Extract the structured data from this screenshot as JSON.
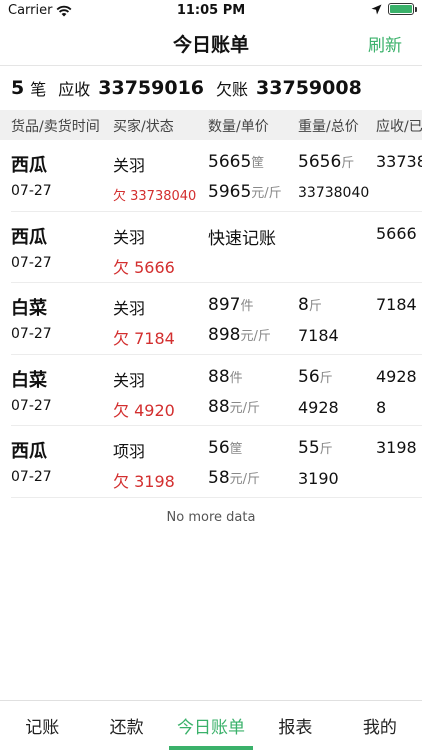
{
  "status_bar": {
    "carrier": "Carrier",
    "time": "11:05 PM"
  },
  "nav": {
    "title": "今日账单",
    "refresh_label": "刷新"
  },
  "summary": {
    "count": "5",
    "count_unit": "笔",
    "receivable_label": "应收",
    "receivable_value": "33759016",
    "owed_label": "欠账",
    "owed_value": "33759008"
  },
  "table_header": {
    "goods_time": "货品/卖货时间",
    "buyer_status": "买家/状态",
    "qty_price": "数量/单价",
    "weight_total": "重量/总价",
    "due": "应收/已"
  },
  "rows": [
    {
      "goods": "西瓜",
      "date": "07-27",
      "buyer": "关羽",
      "status": "欠 33738040",
      "qty": "5665",
      "qty_unit": "筐",
      "price": "5965",
      "price_unit": "元/斤",
      "weight": "5656",
      "weight_unit": "斤",
      "total": "33738040",
      "due": "33738",
      "due2": ""
    },
    {
      "goods": "西瓜",
      "date": "07-27",
      "buyer": "关羽",
      "status": "欠 5666",
      "qty": "快速记账",
      "qty_unit": "",
      "price": "",
      "price_unit": "",
      "weight": "",
      "weight_unit": "",
      "total": "",
      "due": "5666",
      "due2": ""
    },
    {
      "goods": "白菜",
      "date": "07-27",
      "buyer": "关羽",
      "status": "欠 7184",
      "qty": "897",
      "qty_unit": "件",
      "price": "898",
      "price_unit": "元/斤",
      "weight": "8",
      "weight_unit": "斤",
      "total": "7184",
      "due": "7184",
      "due2": ""
    },
    {
      "goods": "白菜",
      "date": "07-27",
      "buyer": "关羽",
      "status": "欠 4920",
      "qty": "88",
      "qty_unit": "件",
      "price": "88",
      "price_unit": "元/斤",
      "weight": "56",
      "weight_unit": "斤",
      "total": "4928",
      "due": "4928",
      "due2": "8"
    },
    {
      "goods": "西瓜",
      "date": "07-27",
      "buyer": "项羽",
      "status": "欠 3198",
      "qty": "56",
      "qty_unit": "筐",
      "price": "58",
      "price_unit": "元/斤",
      "weight": "55",
      "weight_unit": "斤",
      "total": "3190",
      "due": "3198",
      "due2": ""
    }
  ],
  "no_more": "No more data",
  "tabs": [
    {
      "label": "记账"
    },
    {
      "label": "还款"
    },
    {
      "label": "今日账单"
    },
    {
      "label": "报表"
    },
    {
      "label": "我的"
    }
  ],
  "colors": {
    "accent": "#3ab16a",
    "debt_red": "#d32f2f"
  }
}
